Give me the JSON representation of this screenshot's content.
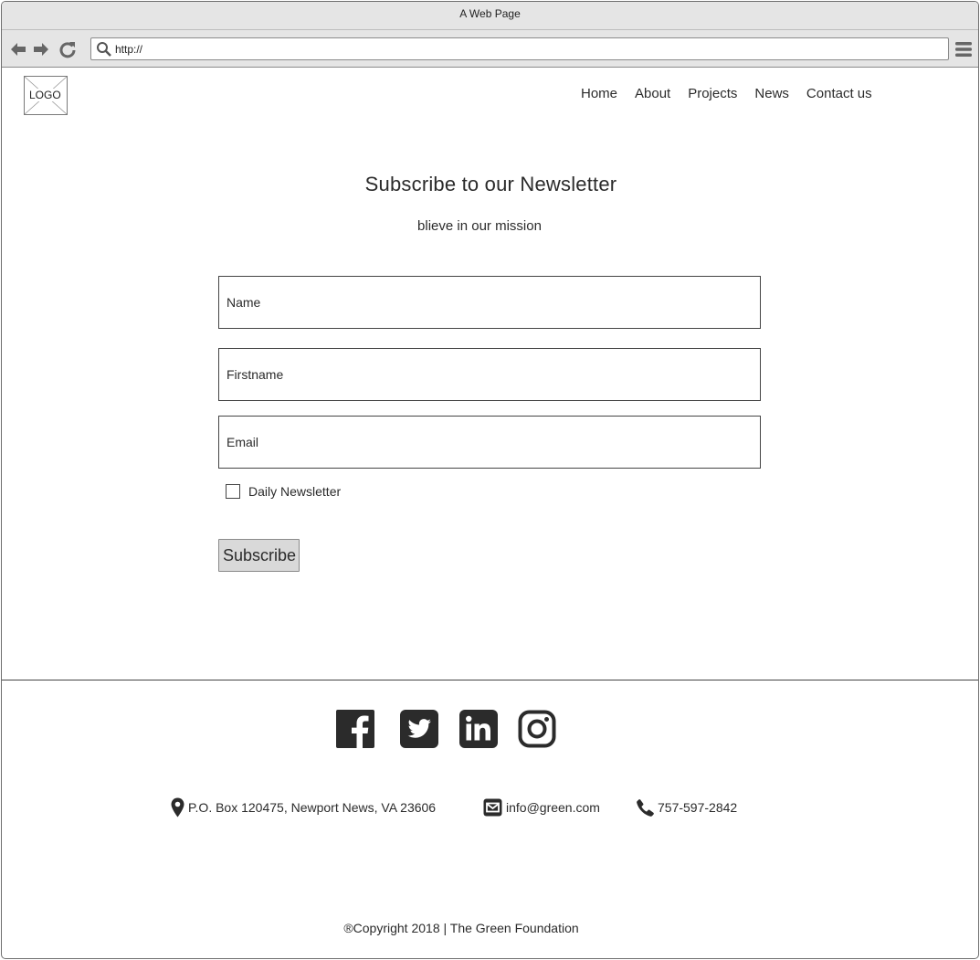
{
  "window": {
    "title": "A Web Page"
  },
  "browser": {
    "url": "http://"
  },
  "logo": {
    "text": "LOGO"
  },
  "nav": {
    "items": [
      "Home",
      "About",
      "Projects",
      "News",
      "Contact us"
    ]
  },
  "main": {
    "heading": "Subscribe to our Newsletter",
    "subheading": "blieve in our mission",
    "fields": {
      "name_placeholder": "Name",
      "firstname_placeholder": "Firstname",
      "email_placeholder": "Email"
    },
    "checkbox_label": "Daily Newsletter",
    "checkbox_checked": false,
    "subscribe_label": "Subscribe"
  },
  "footer": {
    "social_icons": [
      "facebook-icon",
      "twitter-icon",
      "linkedin-icon",
      "instagram-icon"
    ],
    "address": "P.O. Box 120475, Newport News, VA 23606",
    "email": "info@green.com",
    "phone": "757-597-2842",
    "copyright": "®Copyright 2018 | The Green Foundation"
  },
  "colors": {
    "text": "#2b2b2b",
    "chrome": "#e5e5e5",
    "button": "#d9d9d9"
  }
}
